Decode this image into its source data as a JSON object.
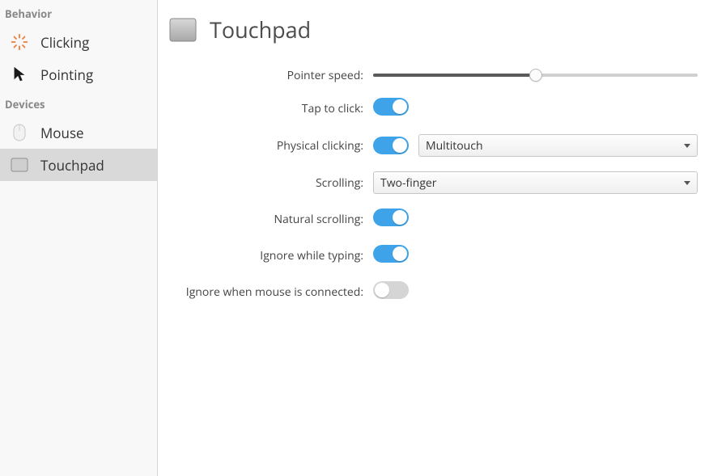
{
  "sidebar": {
    "sections": [
      {
        "title": "Behavior",
        "items": [
          {
            "label": "Clicking",
            "icon": "click-icon"
          },
          {
            "label": "Pointing",
            "icon": "pointer-icon"
          }
        ]
      },
      {
        "title": "Devices",
        "items": [
          {
            "label": "Mouse",
            "icon": "mouse-icon"
          },
          {
            "label": "Touchpad",
            "icon": "touchpad-icon",
            "selected": true
          }
        ]
      }
    ]
  },
  "main": {
    "title": "Touchpad",
    "settings": {
      "pointer_speed": {
        "label": "Pointer speed:",
        "value": 50
      },
      "tap_to_click": {
        "label": "Tap to click:",
        "value": true
      },
      "physical_clicking": {
        "label": "Physical clicking:",
        "value": true,
        "select": "Multitouch"
      },
      "scrolling": {
        "label": "Scrolling:",
        "select": "Two-finger"
      },
      "natural_scrolling": {
        "label": "Natural scrolling:",
        "value": true
      },
      "ignore_while_typing": {
        "label": "Ignore while typing:",
        "value": true
      },
      "ignore_when_mouse": {
        "label": "Ignore when mouse is connected:",
        "value": false
      }
    }
  },
  "colors": {
    "accent": "#3ea3e8",
    "orange": "#f08a4b"
  }
}
